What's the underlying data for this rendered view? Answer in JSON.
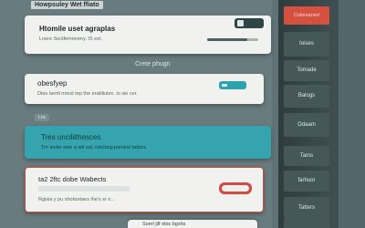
{
  "app": {
    "title": "Howpsuley Wet ffiato"
  },
  "cards": [
    {
      "title": "Htomile uset agraplas",
      "desc": "Lnere Sectfemmomy. IS ext.",
      "slider_value": 0.78
    },
    {
      "title": "obesfyep",
      "desc": "Dtes beml mmxt    tep the erabliulen.  io sie cer."
    },
    {
      "title": "Tres unciliithesces",
      "desc": "Trn ieske sme a wd sst, rotching porsine tatiors."
    },
    {
      "title": "ta2 2ftc dobe Wabects",
      "desc": "Rgisia y pu shobortaes ihe's sr ri..."
    }
  ],
  "section_label": "Crete phugn",
  "tag": "Lta",
  "bottom_bar": "Soerl jilf ebis bgshs",
  "sidebar": {
    "header": "Colionaned",
    "items": [
      "Ioises",
      "Tomade",
      "Balogs",
      "Odaam",
      "Tams",
      "farhuor",
      "Tatters",
      ""
    ]
  },
  "colors": {
    "accent_red": "#d24b3a",
    "accent_teal": "#36a4ae",
    "sidebar_bg": "#38474a"
  }
}
